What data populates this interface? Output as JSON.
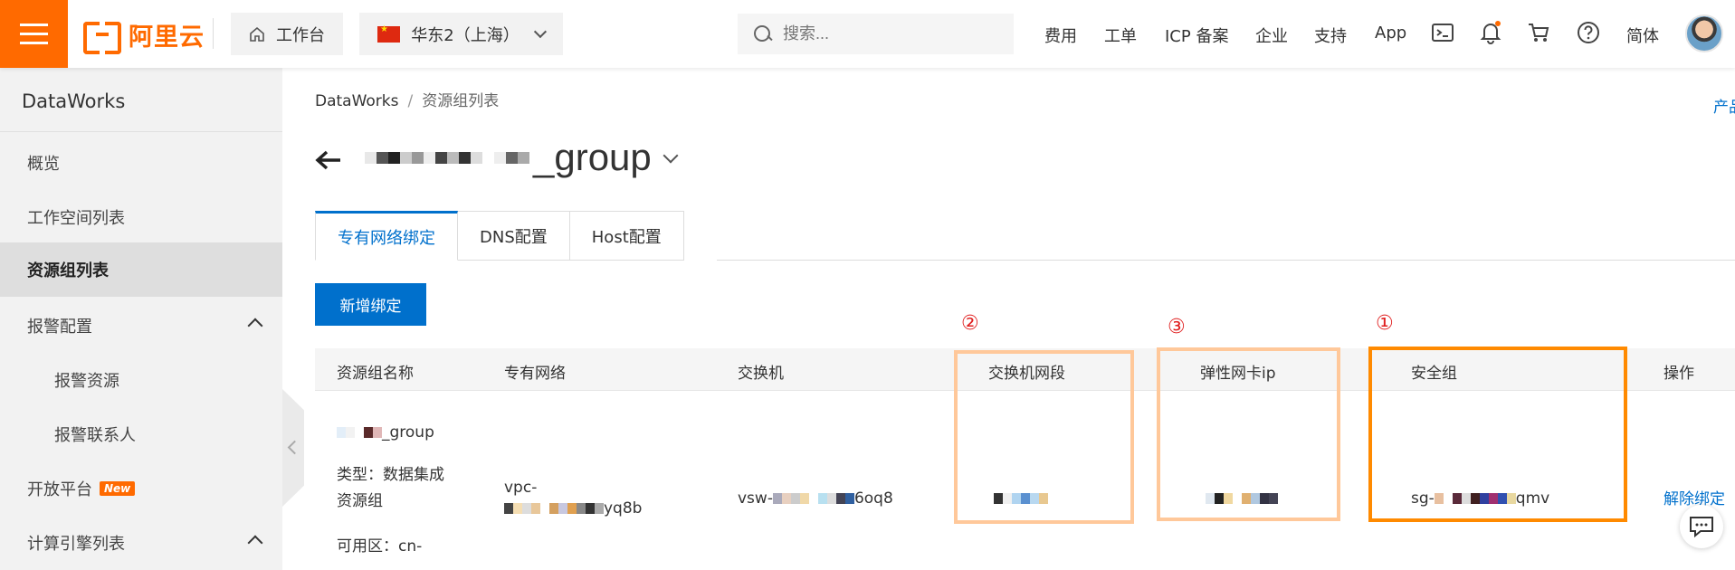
{
  "topbar": {
    "logo_text": "阿里云",
    "workbench_label": "工作台",
    "region_label": "华东2（上海）",
    "search_placeholder": "搜索...",
    "nav": [
      "费用",
      "工单",
      "ICP 备案",
      "企业",
      "支持",
      "App"
    ],
    "lang_label": "简体",
    "colors": {
      "brand": "#ff6a00",
      "notification_dot": "#ff6a00"
    }
  },
  "sidebar": {
    "title": "DataWorks",
    "items": [
      {
        "label": "概览"
      },
      {
        "label": "工作空间列表"
      },
      {
        "label": "资源组列表",
        "active": true
      },
      {
        "label": "报警配置",
        "expanded": true
      },
      {
        "label": "报警资源",
        "sub": true
      },
      {
        "label": "报警联系人",
        "sub": true
      },
      {
        "label": "开放平台",
        "badge": "New"
      },
      {
        "label": "计算引擎列表",
        "expanded": true
      }
    ]
  },
  "main": {
    "breadcrumb": [
      "DataWorks",
      "资源组列表"
    ],
    "product_link": "产品",
    "group_title_suffix": "_group",
    "tabs": [
      {
        "label": "专有网络绑定",
        "active": true
      },
      {
        "label": "DNS配置"
      },
      {
        "label": "Host配置"
      }
    ],
    "add_button": "新增绑定",
    "table": {
      "columns": [
        "资源组名称",
        "专有网络",
        "交换机",
        "交换机网段",
        "弹性网卡ip",
        "安全组",
        "操作"
      ],
      "row": {
        "name_suffix": "_group",
        "type_label": "类型：数据集成",
        "type_label_2": "资源组",
        "zone_label": "可用区：cn-",
        "vpc_prefix": "vpc-",
        "vpc_suffix": "yq8b",
        "vswitch_prefix": "vsw-",
        "vswitch_suffix": "6oq8",
        "sg_prefix": "sg-",
        "sg_suffix": "qmv",
        "action": "解除绑定"
      }
    },
    "annotations": [
      "②",
      "③",
      "①"
    ],
    "colors": {
      "primary": "#0070cc",
      "light_box": "#ffc89a",
      "strong_box": "#ff8a00",
      "marker": "#e02020"
    }
  }
}
